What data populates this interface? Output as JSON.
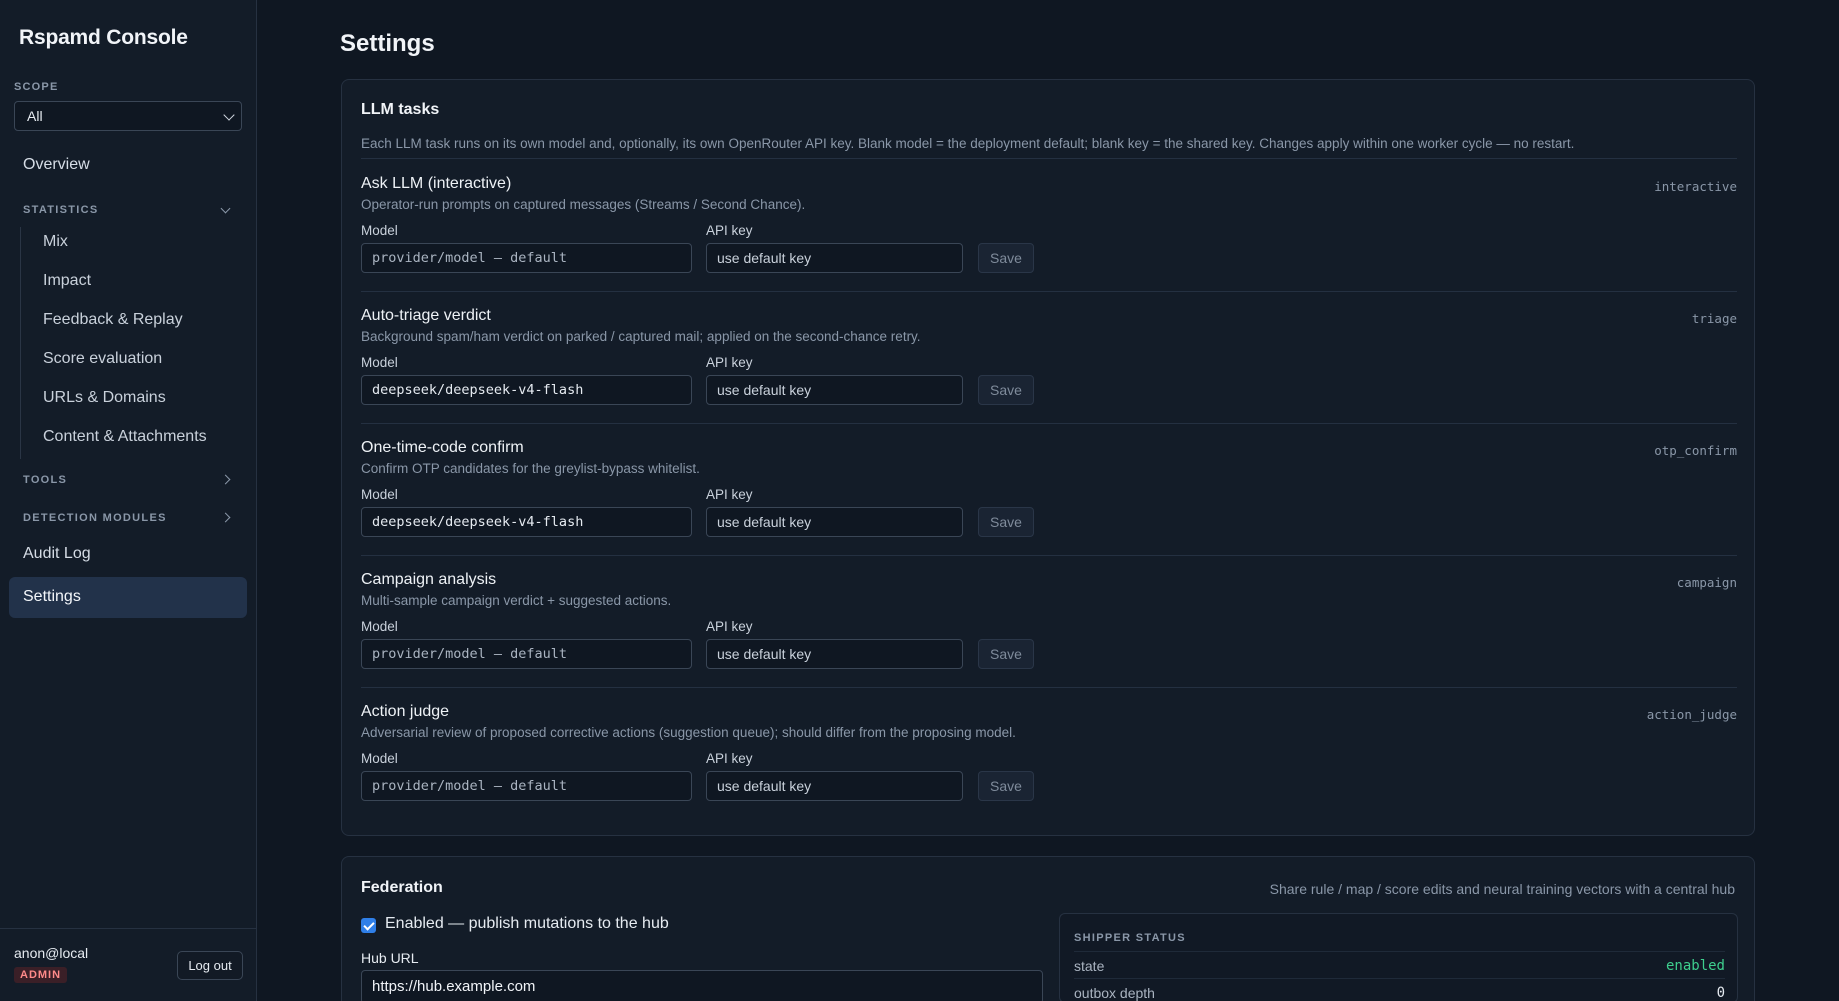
{
  "app": {
    "title": "Rspamd Console"
  },
  "scope": {
    "label": "SCOPE",
    "selected": "All"
  },
  "nav": {
    "overview": "Overview",
    "statistics": {
      "label": "STATISTICS",
      "items": [
        "Mix",
        "Impact",
        "Feedback & Replay",
        "Score evaluation",
        "URLs & Domains",
        "Content & Attachments"
      ]
    },
    "tools": "TOOLS",
    "detection_modules": "DETECTION MODULES",
    "audit_log": "Audit Log",
    "settings": "Settings"
  },
  "user": {
    "email": "anon@local",
    "role": "ADMIN",
    "logout": "Log out"
  },
  "page": {
    "title": "Settings"
  },
  "llm": {
    "title": "LLM tasks",
    "description": "Each LLM task runs on its own model and, optionally, its own OpenRouter API key. Blank model = the deployment default; blank key = the shared key. Changes apply within one worker cycle — no restart.",
    "model_label": "Model",
    "key_label": "API key",
    "save_label": "Save",
    "tasks": [
      {
        "title": "Ask LLM (interactive)",
        "key": "interactive",
        "desc": "Operator-run prompts on captured messages (Streams / Second Chance).",
        "model": "provider/model — default",
        "api_key": "use default key"
      },
      {
        "title": "Auto-triage verdict",
        "key": "triage",
        "desc": "Background spam/ham verdict on parked / captured mail; applied on the second-chance retry.",
        "model": "deepseek/deepseek-v4-flash",
        "api_key": "use default key"
      },
      {
        "title": "One-time-code confirm",
        "key": "otp_confirm",
        "desc": "Confirm OTP candidates for the greylist-bypass whitelist.",
        "model": "deepseek/deepseek-v4-flash",
        "api_key": "use default key"
      },
      {
        "title": "Campaign analysis",
        "key": "campaign",
        "desc": "Multi-sample campaign verdict + suggested actions.",
        "model": "provider/model — default",
        "api_key": "use default key"
      },
      {
        "title": "Action judge",
        "key": "action_judge",
        "desc": "Adversarial review of proposed corrective actions (suggestion queue); should differ from the proposing model.",
        "model": "provider/model — default",
        "api_key": "use default key"
      }
    ]
  },
  "federation": {
    "title": "Federation",
    "description": "Share rule / map / score edits and neural training vectors with a central hub",
    "enabled_label": "Enabled — publish mutations to the hub",
    "hub_url_label": "Hub URL",
    "hub_url": "https://hub.example.com",
    "shipper": {
      "title": "SHIPPER STATUS",
      "rows": [
        {
          "key": "state",
          "value": "enabled"
        },
        {
          "key": "outbox depth",
          "value": "0"
        }
      ]
    }
  },
  "colors": {
    "accent": "#2f7fe8",
    "status_ok": "#3ecf8e",
    "role_badge": "#ff8a8a"
  }
}
